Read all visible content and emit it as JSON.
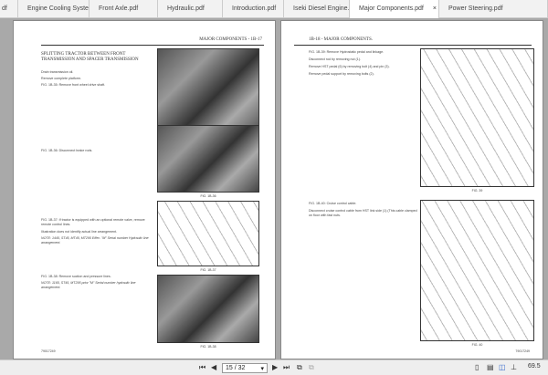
{
  "tabs": [
    {
      "label": "df"
    },
    {
      "label": "Engine Cooling Syste..."
    },
    {
      "label": "Front Axle.pdf"
    },
    {
      "label": "Hydraulic.pdf"
    },
    {
      "label": "Introduction.pdf"
    },
    {
      "label": "Iseki Diesel Engine.pdf"
    },
    {
      "label": "Major Components.pdf",
      "active": true
    },
    {
      "label": "Power Steering.pdf"
    }
  ],
  "close": "×",
  "left": {
    "header": "MAJOR COMPONENTS - 1B-17",
    "title": "SPLITTING TRACTOR BETWEEN FRONT TRANSMISSION AND SPACER TRANSMISSION",
    "p1": "Drain transmission oil.",
    "p2": "Remove complete platform.",
    "f35": "FIG. 1B-35: Remove front wheel drive shaft.",
    "f36": "FIG. 1B-36: Disconnect brake rods.",
    "f37": "FIG. 1B-37: If tractor is equipped with an optional remote valve, remove remote control lines.",
    "p3": "Illustration does not identify actual line arrangement.",
    "n1": "NOTE: 1445, ST45, MT45, MT295 Effec. \"M\" Serial number Hydraulic line arrangement.",
    "f38": "FIG. 1B-38: Remove suction and pressure lines.",
    "n2": "NOTE: 1165, ST45, MT295 prior \"M\" Serial number hydraulic line arrangement.",
    "c35": "FIG. 1B-35",
    "c36": "FIG. 1B-36",
    "c37": "FIG. 1B-37",
    "c38": "FIG. 1B-38",
    "footer": "79017249"
  },
  "right": {
    "header": "1B-18 - MAJOR COMPONENTS.",
    "f39": "FIG. 1B-39: Remove Hydrostatic pedal and linkage.",
    "p1": "Disconnect rod by removing nut (1).",
    "p2": "Remove HST pedal (6) by removing bolt (4) and pin (3).",
    "p3": "Remove pedal support by removing bolts (2).",
    "f40": "FIG. 1B-40: Cruise control cable.",
    "p4": "Disconnect cruise control cable from HST link side (1) (This cable clamped on floor with fast nuts.",
    "c39": "FIG. 39",
    "c40": "FIG. 40",
    "footer": "79017249"
  },
  "toolbar": {
    "page": "15 / 32",
    "zoom": "69.5"
  }
}
